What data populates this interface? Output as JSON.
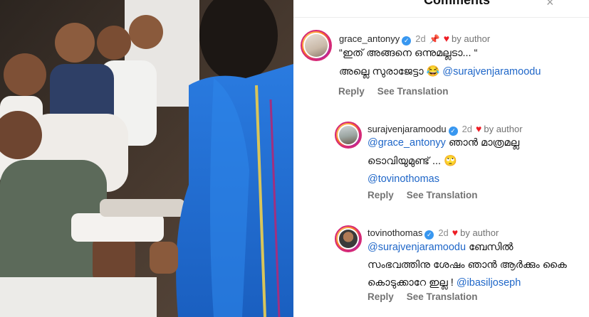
{
  "header": {
    "title": "Comments",
    "close_label": "×"
  },
  "comments": [
    {
      "username": "grace_antonyy",
      "time": "2d",
      "pin": "📌",
      "heart": "♥",
      "by_author": "by author",
      "line1": "“ഇത് അങ്ങനെ ഒന്നുമല്ലടാ... “",
      "line2_text": "അല്ലെ സുരാജേട്ടാ ",
      "line2_emoji": "😂",
      "line2_mention": "@surajvenjaramoodu",
      "reply": "Reply",
      "see_translation": "See Translation"
    },
    {
      "username": "surajvenjaramoodu",
      "time": "2d",
      "heart": "♥",
      "by_author": "by author",
      "line1_mention": "@grace_antonyy",
      "line1_text": " ഞാൻ മാത്രമല്ല",
      "line2_text": "ടൊവിയുമുണ്ട് ... ",
      "line2_emoji": "🙄",
      "line3_mention": "@tovinothomas",
      "reply": "Reply",
      "see_translation": "See Translation"
    },
    {
      "username": "tovinothomas",
      "time": "2d",
      "heart": "♥",
      "by_author": "by author",
      "line1_mention": "@surajvenjaramoodu",
      "line1_text": " ബേസിൽ",
      "line2_text": "സംഭവത്തിനു ശേഷം ഞാൻ ആർക്കും കൈ",
      "line3_text": "കൊടുക്കാറേ ഇല്ല ! ",
      "line3_mention": "@ibasiljoseph",
      "reply": "Reply",
      "see_translation": "See Translation"
    }
  ],
  "colors": {
    "mention": "#1e66c8",
    "heart": "#ed1c24",
    "verified": "#3897f0",
    "blue_saree": "#1f6fd1"
  },
  "icons": [
    "verified-badge-icon",
    "pin-icon",
    "heart-icon",
    "close-icon"
  ]
}
